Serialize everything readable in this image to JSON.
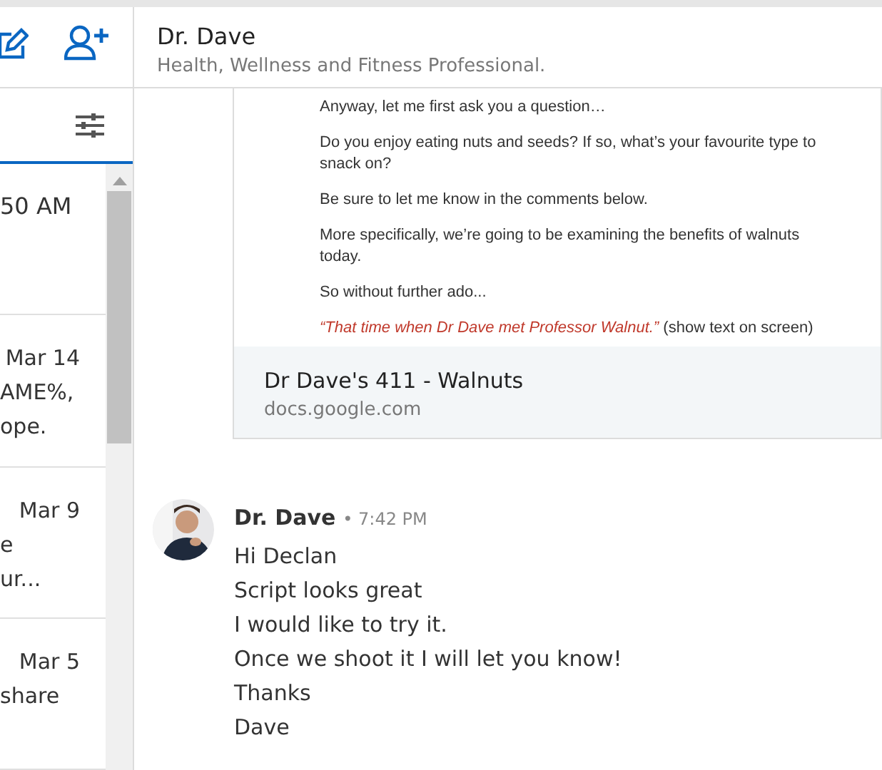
{
  "sidebar": {
    "items": [
      {
        "time": "50 AM"
      },
      {
        "time": "Mar 14",
        "lines": [
          "AME%,",
          "ope."
        ]
      },
      {
        "time": "Mar 9",
        "lines": [
          "e",
          "ur..."
        ]
      },
      {
        "time": "Mar 5",
        "lines": [
          "share"
        ]
      }
    ]
  },
  "conversation": {
    "title": "Dr. Dave",
    "subtitle": "Health, Wellness and Fitness Professional."
  },
  "link_preview": {
    "document": [
      {
        "kind": "text",
        "text": "Anyway, let me first ask you a question…"
      },
      {
        "kind": "text",
        "text": "Do you enjoy eating nuts and seeds? If so, what’s your favourite type to snack on?"
      },
      {
        "kind": "text",
        "text": "Be sure to let me know in the comments below."
      },
      {
        "kind": "text",
        "text": "More specifically, we’re going to be examining the benefits of walnuts today."
      },
      {
        "kind": "text",
        "text": "So without further ado..."
      },
      {
        "kind": "quote",
        "quote": "“That time when Dr Dave met Professor Walnut.”",
        "note": "(show text on screen)"
      }
    ],
    "title": "Dr Dave's 411 - Walnuts",
    "domain": "docs.google.com"
  },
  "message": {
    "sender": "Dr. Dave",
    "time": "• 7:42 PM",
    "lines": [
      "Hi Declan",
      "Script looks great",
      "I would like to try it.",
      "Once we shoot it I will let you know!",
      "Thanks",
      "Dave"
    ]
  }
}
